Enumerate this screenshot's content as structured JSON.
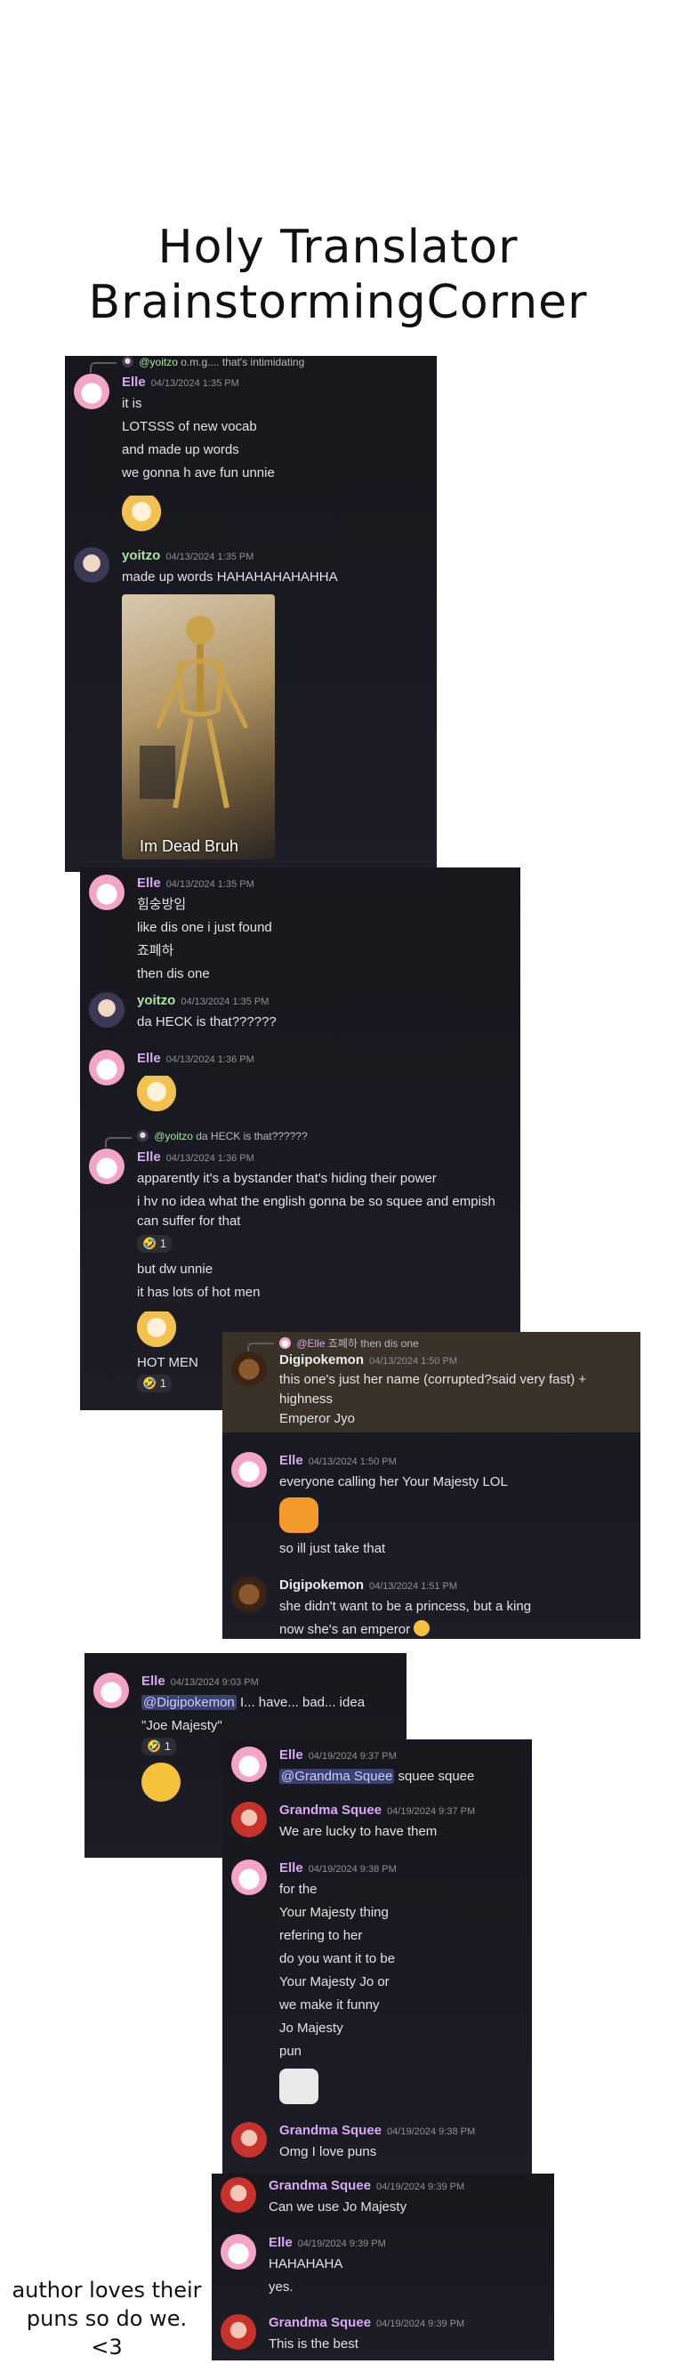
{
  "title": {
    "line1": "Holy Translator",
    "line2": "BrainstormingCorner"
  },
  "panel1": {
    "reply": {
      "author": "@yoitzo",
      "text": "o.m.g.... that's intimidating"
    },
    "messages": [
      {
        "name": "Elle",
        "time": "04/13/2024 1:35 PM",
        "lines": [
          "it is",
          "LOTSSS of new vocab",
          "and made up words",
          "we gonna h ave fun unnie"
        ]
      },
      {
        "name": "yoitzo",
        "time": "04/13/2024 1:35 PM",
        "lines": [
          "made up words HAHAHAHAHAHHA"
        ],
        "video_caption": "Im Dead Bruh"
      }
    ]
  },
  "panel2": {
    "messages": [
      {
        "name": "Elle",
        "time": "04/13/2024 1:35 PM",
        "lines": [
          "힘숭방임",
          "like dis one i just found",
          "죠폐하",
          "then dis one"
        ]
      },
      {
        "name": "yoitzo",
        "time": "04/13/2024 1:35 PM",
        "lines": [
          "da HECK is that??????"
        ]
      },
      {
        "name": "Elle",
        "time": "04/13/2024 1:36 PM",
        "lines": []
      },
      {
        "reply": {
          "author": "@yoitzo",
          "text": "da HECK is that??????"
        },
        "name": "Elle",
        "time": "04/13/2024 1:36 PM",
        "lines": [
          "apparently it's a bystander that's hiding their power",
          "i hv no idea what the english gonna be so squee and empish",
          "can suffer for that"
        ],
        "reaction": "🤣 1",
        "lines2": [
          "but dw unnie",
          "it has lots of hot men"
        ],
        "lines3": [
          "HOT MEN"
        ],
        "reaction2": "🤣 1"
      }
    ]
  },
  "panel3": {
    "reply": {
      "author": "@Elle",
      "text": "죠폐하 then dis one"
    },
    "messages": [
      {
        "name": "Digipokemon",
        "time": "04/13/2024 1:50 PM",
        "lines": [
          "this one's just her name (corrupted?said very fast) +",
          "highness",
          "Emperor Jyo"
        ]
      },
      {
        "name": "Elle",
        "time": "04/13/2024 1:50 PM",
        "lines": [
          "everyone calling her Your Majesty LOL"
        ],
        "lines2": [
          "so ill just take that"
        ]
      },
      {
        "name": "Digipokemon",
        "time": "04/13/2024 1:51 PM",
        "lines": [
          "she didn't want to be a princess, but a king",
          "now she's an emperor"
        ]
      }
    ]
  },
  "panel4": {
    "messages": [
      {
        "name": "Elle",
        "time": "04/13/2024 9:03 PM",
        "mention": "@Digipokemon",
        "text_after": " I... have... bad... idea",
        "lines": [
          "\"Joe Majesty\""
        ],
        "reaction": "🤣 1"
      }
    ]
  },
  "panel5": {
    "messages": [
      {
        "name": "Elle",
        "time": "04/19/2024 9:37 PM",
        "mention": "@Grandma Squee",
        "text_after": " squee squee"
      },
      {
        "name": "Grandma Squee",
        "time": "04/19/2024 9:37 PM",
        "lines": [
          "We are lucky to have them"
        ]
      },
      {
        "name": "Elle",
        "time": "04/19/2024 9:38 PM",
        "lines": [
          "for the",
          "Your Majesty thing",
          "refering to her",
          "do you want it to be",
          "Your Majesty Jo or",
          "we make it funny",
          "Jo Majesty",
          "pun"
        ]
      },
      {
        "name": "Grandma Squee",
        "time": "04/19/2024 9:38 PM",
        "lines": [
          "Omg I love puns"
        ]
      }
    ]
  },
  "panel6": {
    "messages": [
      {
        "name": "Grandma Squee",
        "time": "04/19/2024 9:39 PM",
        "lines": [
          "Can we use Jo Majesty"
        ]
      },
      {
        "name": "Elle",
        "time": "04/19/2024 9:39 PM",
        "lines": [
          "HAHAHAHA",
          "yes."
        ]
      },
      {
        "name": "Grandma Squee",
        "time": "04/19/2024 9:39 PM",
        "lines": [
          "This is the best"
        ]
      }
    ]
  },
  "footer_note": {
    "line1": "author loves their",
    "line2": "puns so do we.",
    "line3": "<3"
  },
  "colors": {
    "panel_bg": "#17171d",
    "name_purple": "#d9a8f5",
    "name_green": "#a8e6a0",
    "mention_bg": "#3c4270"
  }
}
